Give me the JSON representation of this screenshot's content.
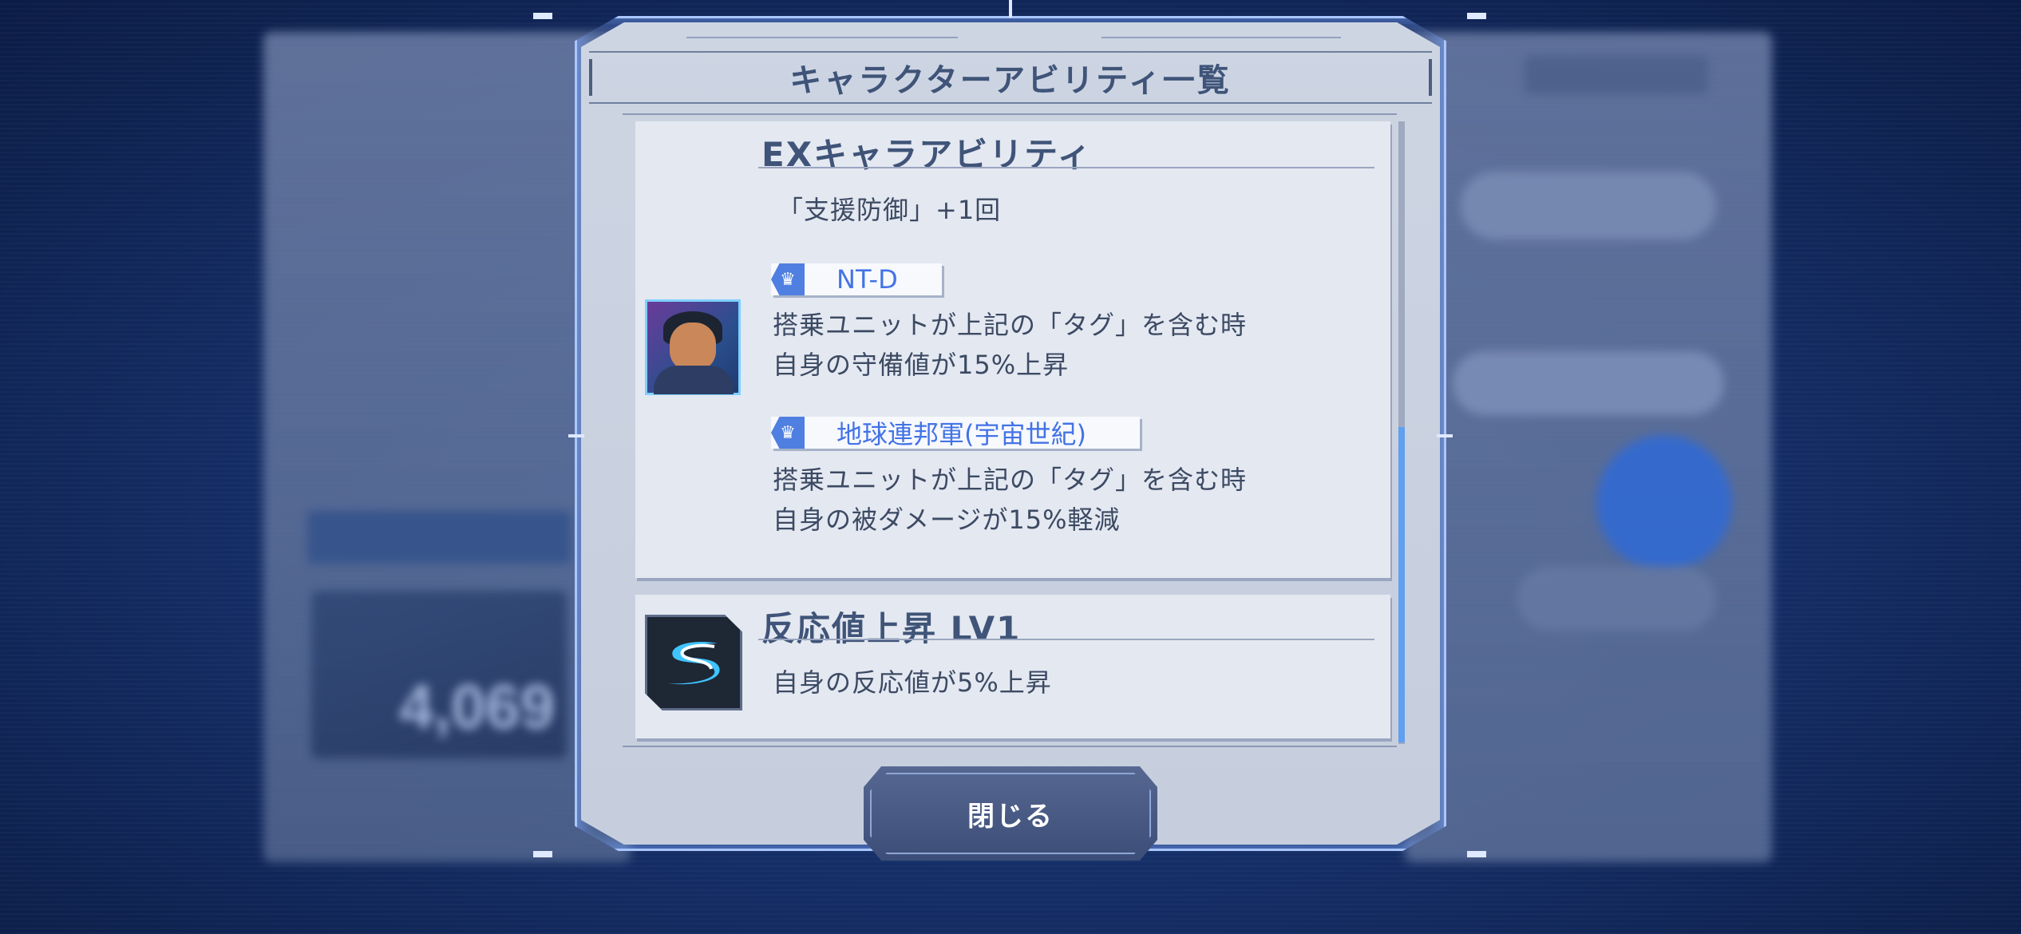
{
  "modal": {
    "title": "キャラクターアビリティ一覧",
    "close_label": "閉じる"
  },
  "ex_ability": {
    "title": "EXキャラアビリティ",
    "description": "「支援防御」+1回",
    "tags": [
      {
        "label": "NT-D",
        "condition": "搭乗ユニットが上記の「タグ」を含む時",
        "effect": "自身の守備値が15%上昇"
      },
      {
        "label": "地球連邦軍(宇宙世紀)",
        "condition": "搭乗ユニットが上記の「タグ」を含む時",
        "effect": "自身の被ダメージが15%軽減"
      }
    ]
  },
  "skill": {
    "title": "反応値上昇 LV1",
    "description": "自身の反応値が5%上昇"
  },
  "background": {
    "number": "4,069"
  },
  "colors": {
    "accent": "#4373e6",
    "panel": "#cdd5e3",
    "title_text": "#3f5478",
    "button": "#3c4e78"
  }
}
